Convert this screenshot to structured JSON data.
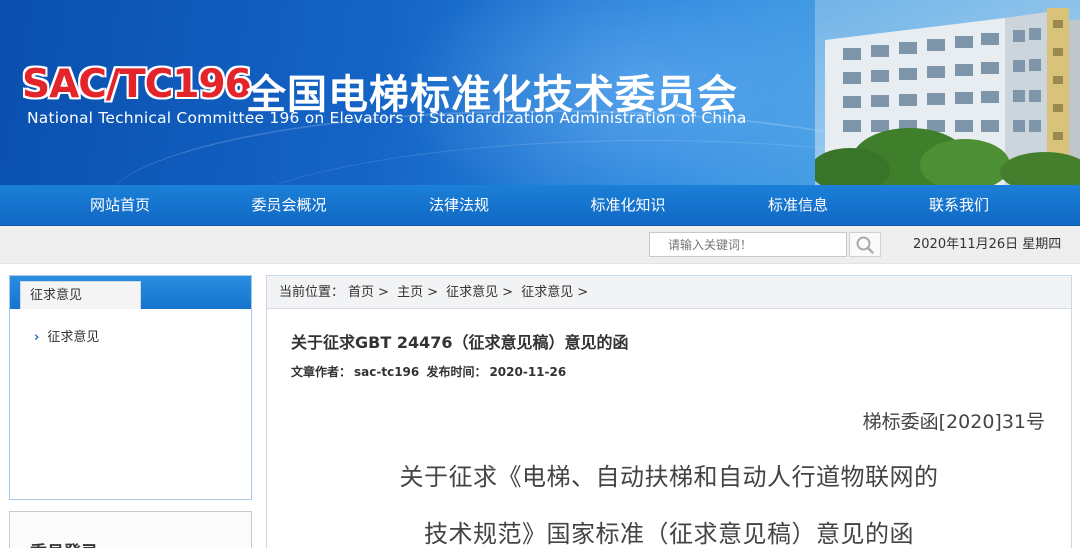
{
  "header": {
    "logo_code": "SAC/TC196",
    "logo_cn": "全国电梯标准化技术委员会",
    "logo_en": "National Technical Committee 196 on Elevators of Standardization Administration of China"
  },
  "nav": {
    "items": [
      {
        "label": "网站首页"
      },
      {
        "label": "委员会概况"
      },
      {
        "label": "法律法规"
      },
      {
        "label": "标准化知识"
      },
      {
        "label": "标准信息"
      },
      {
        "label": "联系我们"
      }
    ]
  },
  "search": {
    "placeholder": "请输入关键词！",
    "date": "2020年11月26日 星期四"
  },
  "sidebar": {
    "box_title": "征求意见",
    "items": [
      {
        "label": "征求意见"
      }
    ],
    "box2_title": "委员登录"
  },
  "breadcrumb": {
    "prefix": "当前位置：",
    "items": [
      "首页",
      "主页",
      "征求意见",
      "征求意见"
    ],
    "sep": ">"
  },
  "article": {
    "title": "关于征求GBT 24476（征求意见稿）意见的函",
    "author_label": "文章作者：",
    "author": "sac-tc196",
    "date_label": "发布时间：",
    "date": "2020-11-26",
    "doc_no": "梯标委函[2020]31号",
    "heading_line1": "关于征求《电梯、自动扶梯和自动人行道物联网的",
    "heading_line2": "技术规范》国家标准（征求意见稿）意见的函"
  },
  "colors": {
    "brand_blue": "#1068c4",
    "logo_red": "#e3242b"
  },
  "icons": {
    "search": "search-icon",
    "sidebar_arrow": "chevron-right-icon"
  }
}
